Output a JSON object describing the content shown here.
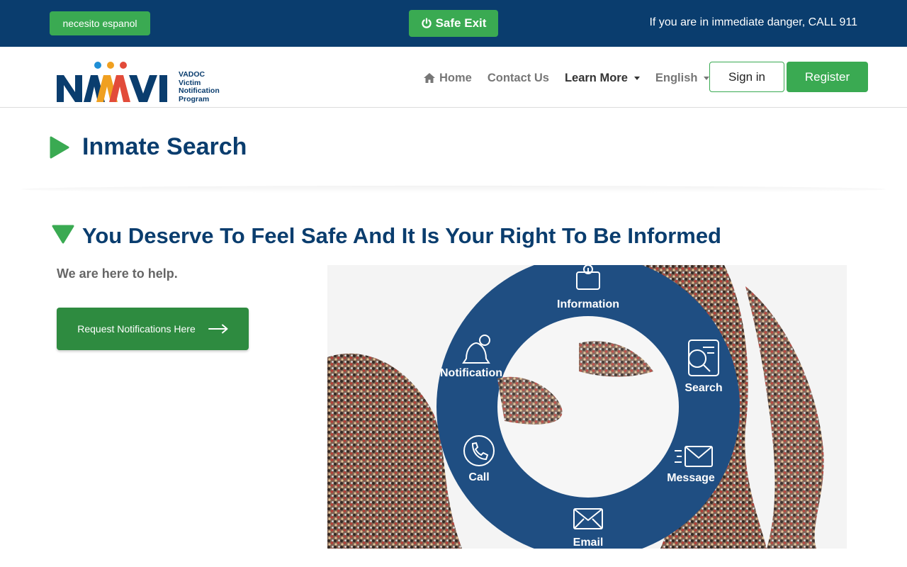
{
  "topbar": {
    "spanish_label": "necesito espanol",
    "safe_exit_label": "Safe Exit",
    "danger_text": "If you are in immediate danger, CALL 911"
  },
  "logo": {
    "wordmark": "NAVI",
    "subtitle": [
      "VADOC",
      "Victim",
      "Notification",
      "Program"
    ]
  },
  "nav": {
    "home": "Home",
    "contact": "Contact Us",
    "learn_more": "Learn More",
    "language": "English",
    "signin": "Sign in",
    "register": "Register"
  },
  "page": {
    "title": "Inmate Search"
  },
  "hero": {
    "heading": "You Deserve To Feel Safe And It Is Your Right To Be Informed",
    "subtext": "We are here to help.",
    "cta_label": "Request Notifications Here",
    "ring_items": [
      "Information",
      "Notification",
      "Search",
      "Call",
      "Message",
      "Email"
    ]
  },
  "colors": {
    "navy": "#0a3d6e",
    "green": "#3aaa52",
    "dark_green": "#2e8b40",
    "ring_blue": "#1f4e82"
  },
  "icons": [
    "power-icon",
    "home-icon",
    "play-icon",
    "triangle-down-icon",
    "arrow-right-icon",
    "info-icon",
    "bell-icon",
    "search-doc-icon",
    "phone-icon",
    "message-icon",
    "email-icon"
  ]
}
